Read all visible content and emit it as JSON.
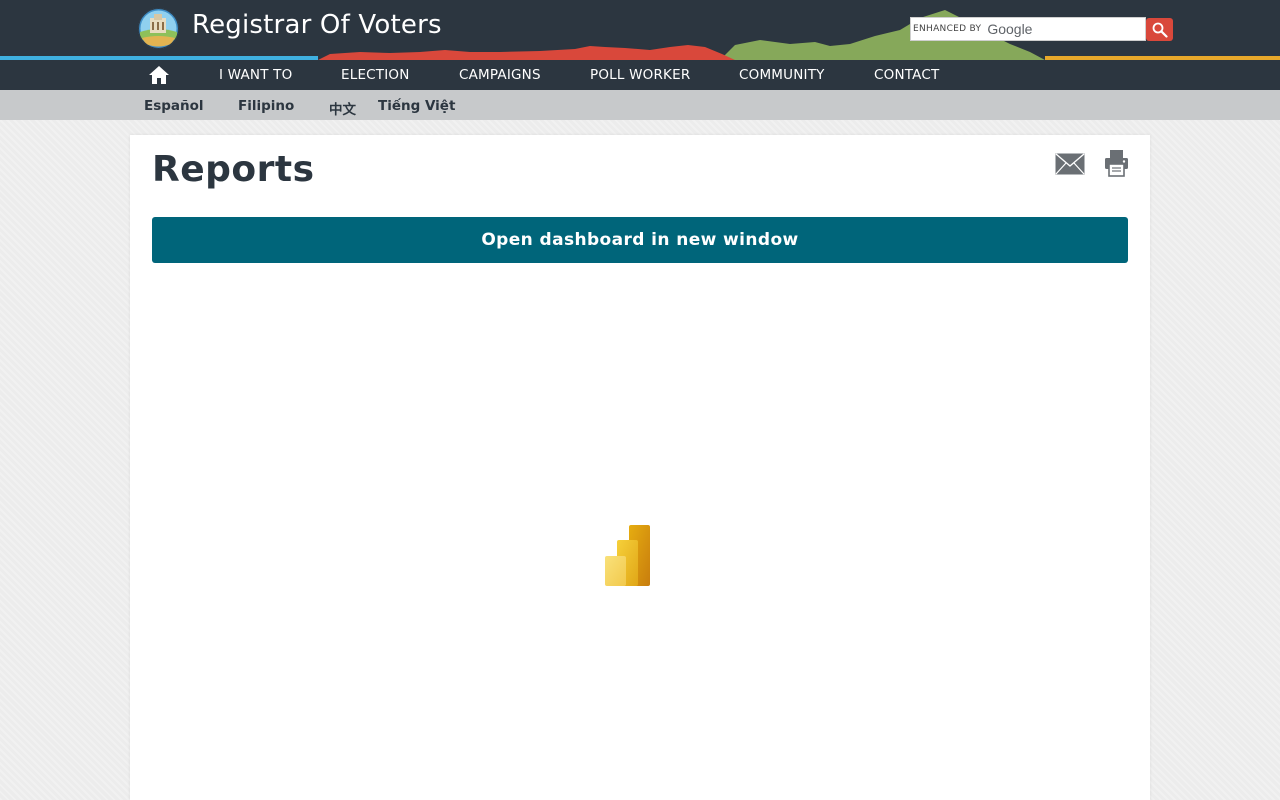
{
  "header": {
    "site_title": "Registrar Of Voters",
    "logo_icon": "county-seal-icon",
    "search": {
      "enhanced_label": "ENHANCED BY",
      "google_label": "Google",
      "value": "",
      "button_icon": "search-icon"
    },
    "colors": {
      "background": "#2c3640",
      "accent_blue": "#3fb0e0",
      "accent_red": "#d9483b",
      "accent_green": "#86a85a",
      "accent_yellow": "#e8a82a"
    }
  },
  "nav": {
    "home_icon": "home-icon",
    "items": [
      {
        "label": "I WANT TO"
      },
      {
        "label": "ELECTION"
      },
      {
        "label": "CAMPAIGNS"
      },
      {
        "label": "POLL WORKER"
      },
      {
        "label": "COMMUNITY"
      },
      {
        "label": "CONTACT"
      }
    ]
  },
  "languages": [
    {
      "label": "Español"
    },
    {
      "label": "Filipino"
    },
    {
      "label": "中文"
    },
    {
      "label": "Tiếng Việt"
    }
  ],
  "main": {
    "title": "Reports",
    "email_icon": "mail-icon",
    "print_icon": "print-icon",
    "open_button_label": "Open dashboard in new window",
    "button_color": "#00657a",
    "embed_icon": "power-bi-logo-icon"
  }
}
